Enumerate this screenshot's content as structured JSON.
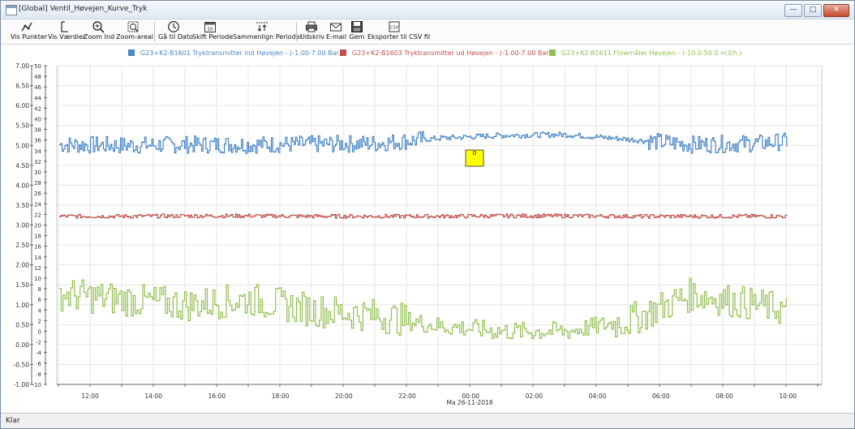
{
  "window": {
    "title": "[Global] Ventil_Høvejen_Kurve_Tryk",
    "buttons": {
      "minimize": "—",
      "restore": "□",
      "close": "✕"
    }
  },
  "toolbar": {
    "items": [
      {
        "label": "Vis Punkter",
        "icon": "line-points-icon"
      },
      {
        "label": "Vis Værdier",
        "icon": "values-icon"
      },
      {
        "label": "Zoom Ind",
        "icon": "zoom-in-icon"
      },
      {
        "label": "Zoom-areal",
        "icon": "zoom-area-icon"
      },
      {
        "label": "Gå til Dato",
        "icon": "clock-icon"
      },
      {
        "label": "Skift Periode",
        "icon": "calendar-icon"
      },
      {
        "label": "Sammenlign Perioder",
        "icon": "compare-icon"
      },
      {
        "label": "Udskriv",
        "icon": "printer-icon"
      },
      {
        "label": "E-mail",
        "icon": "email-icon"
      },
      {
        "label": "Gem",
        "icon": "save-icon"
      },
      {
        "label": "Eksporter til CSV fil",
        "icon": "csv-export-icon"
      }
    ],
    "calendar_number": "30"
  },
  "status_bar": {
    "text": "Klar"
  },
  "marker": {
    "label": "0",
    "color": "#ffff00"
  },
  "colors": {
    "blue": "#4a86c8",
    "red": "#c0504d",
    "green": "#92c050",
    "grid": "#e3e3e3",
    "axis": "#8e8e8e"
  },
  "chart_data": {
    "type": "line",
    "x_tick_labels": [
      "12:00",
      "14:00",
      "16:00",
      "18:00",
      "20:00",
      "22:00",
      "00:00",
      "02:00",
      "04:00",
      "06:00",
      "08:00",
      "10:00"
    ],
    "x_date_label": "Ma 26-11-2018",
    "y_left_ticks": [
      "7.00",
      "6.50",
      "6.00",
      "5.50",
      "5.00",
      "4.50",
      "4.00",
      "3.50",
      "3.00",
      "2.50",
      "2.00",
      "1.50",
      "1.00",
      "0.50",
      "0.00",
      "-0.50",
      "-1.00"
    ],
    "y_left_range": [
      -1,
      7
    ],
    "y_right_ticks": [
      "50",
      "48",
      "46",
      "44",
      "42",
      "40",
      "38",
      "36",
      "34",
      "32",
      "30",
      "28",
      "26",
      "24",
      "22",
      "20",
      "18",
      "16",
      "14",
      "12",
      "10",
      "8",
      "6",
      "4",
      "2",
      "0",
      "-2",
      "-4",
      "-6",
      "-8",
      "-10"
    ],
    "y_right_range": [
      -10,
      50
    ],
    "grid": true,
    "legend_position": "top",
    "series": [
      {
        "name": "G23+K2-B1601 Tryktransmitter ind Høvejen - (-1.00-7.00 Bar.)",
        "color": "#4a86c8",
        "x": [
          0,
          2,
          4,
          6,
          8,
          10,
          12,
          14,
          16,
          18,
          20,
          22,
          23
        ],
        "y": [
          5.02,
          5.0,
          5.02,
          5.02,
          5.03,
          5.05,
          5.18,
          5.25,
          5.27,
          5.15,
          5.02,
          5.05,
          5.1
        ]
      },
      {
        "name": "G23+K2-B1603 Tryktransmitter ud Høvejen - (-1.00-7.00 Bar.)",
        "color": "#c0504d",
        "x": [
          0,
          2,
          4,
          6,
          8,
          10,
          12,
          14,
          16,
          18,
          20,
          22,
          23
        ],
        "y": [
          3.22,
          3.22,
          3.23,
          3.23,
          3.22,
          3.22,
          3.22,
          3.23,
          3.23,
          3.22,
          3.22,
          3.22,
          3.22
        ]
      },
      {
        "name": "G23+K2-B1611 Flowmåler Høvejen - (-10.0-50.0 m3/h.)",
        "color": "#92c050",
        "x": [
          0,
          2,
          4,
          6,
          8,
          10,
          12,
          14,
          16,
          18,
          20,
          22,
          23
        ],
        "y": [
          7,
          6,
          5,
          6,
          4,
          3,
          1,
          0,
          0,
          2,
          7,
          5,
          4
        ]
      }
    ]
  }
}
